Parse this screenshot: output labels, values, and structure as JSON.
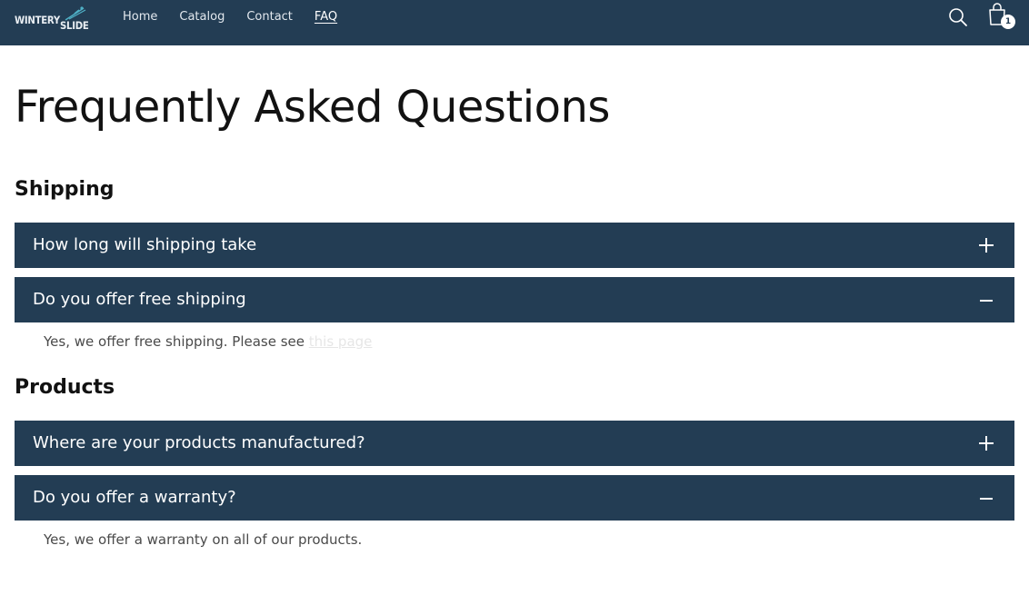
{
  "brand": {
    "logo_line1": "WINTERY",
    "logo_line2": "SLIDE"
  },
  "nav": {
    "items": [
      {
        "label": "Home"
      },
      {
        "label": "Catalog"
      },
      {
        "label": "Contact"
      },
      {
        "label": "FAQ",
        "active": true
      }
    ]
  },
  "header_icons": {
    "search": "search-icon",
    "cart": "cart-icon",
    "cart_count": "1"
  },
  "page": {
    "title": "Frequently Asked Questions"
  },
  "sections": [
    {
      "heading": "Shipping",
      "faqs": [
        {
          "question": "How long will shipping take",
          "expanded": false,
          "toggle_icon": "plus-icon"
        },
        {
          "question": "Do you offer free shipping",
          "expanded": true,
          "toggle_icon": "minus-icon",
          "answer_text": "Yes, we offer free shipping. Please see",
          "answer_link": "this page"
        }
      ]
    },
    {
      "heading": "Products",
      "faqs": [
        {
          "question": "Where are your products manufactured?",
          "expanded": false,
          "toggle_icon": "plus-icon"
        },
        {
          "question": "Do you offer a warranty?",
          "expanded": true,
          "toggle_icon": "minus-icon",
          "answer_text": "Yes, we offer a warranty on all of our products."
        }
      ]
    }
  ],
  "colors": {
    "header_bg": "#233d54",
    "accordion_bg": "#233d54",
    "text": "#121212",
    "answer_text": "#4a4a4a"
  }
}
